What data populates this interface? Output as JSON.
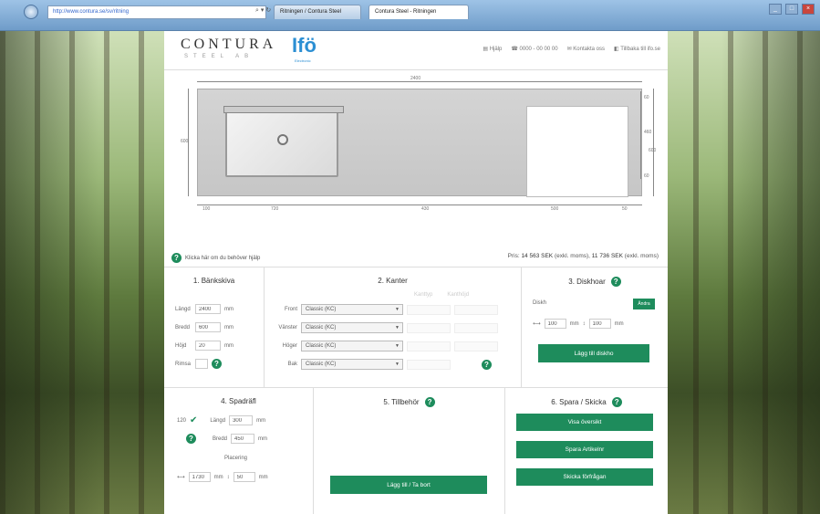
{
  "browser": {
    "address": "http://www.contura.se/sv/ritning",
    "tabs": [
      "Ritningen / Contura Steel",
      "Contura Steel - Ritningen"
    ],
    "win_buttons": [
      "_",
      "□",
      "×"
    ]
  },
  "header": {
    "logo": "CONTURA",
    "logo_sub": "STEEL AB",
    "partner_logo": "Ifö",
    "partner_sub": "Electronic",
    "nav": [
      "Hjälp",
      "0000 - 00 00 00",
      "Kontakta oss",
      "Tillbaka till ifo.se"
    ]
  },
  "drawing": {
    "top_length": "2400",
    "left_height": "600",
    "bottom_dims": [
      "100",
      "720",
      "430",
      "500",
      "50"
    ],
    "right_dims_a": [
      "60",
      "460",
      "60"
    ],
    "right_dims_b": "600"
  },
  "help_link": "Klicka här om du behöver hjälp",
  "price": {
    "label": "Pris:",
    "excl": "14 563 SEK",
    "excl_note": "(exkl. moms),",
    "incl": "11 736 SEK",
    "incl_note": "(exkl. moms)"
  },
  "bankskiva": {
    "title": "1. Bänkskiva",
    "fields": [
      {
        "label": "Längd",
        "value": "2400",
        "unit": "mm"
      },
      {
        "label": "Bredd",
        "value": "600",
        "unit": "mm"
      },
      {
        "label": "Höjd",
        "value": "20",
        "unit": "mm"
      }
    ],
    "rimsa_label": "Rimsa"
  },
  "kanter": {
    "title": "2. Kanter",
    "rows": [
      {
        "label": "Front",
        "value": "Classic (KC)"
      },
      {
        "label": "Vänster",
        "value": "Classic (KC)"
      },
      {
        "label": "Höger",
        "value": "Classic (KC)"
      },
      {
        "label": "Bak",
        "value": "Classic (KC)"
      }
    ],
    "ghost_cols": [
      "Kanttyp",
      "Kanthöjd"
    ]
  },
  "diskhoar": {
    "title": "3. Diskhoar",
    "item": "Diskh",
    "item_btn": "Ändra",
    "x_value": "100",
    "x_unit": "mm",
    "y_value": "100",
    "y_unit": "mm",
    "add_button": "Lägg till diskho"
  },
  "spadrafl": {
    "title": "4. Spadräfl",
    "label_120": "120",
    "length_label": "Längd",
    "length_value": "300",
    "length_unit": "mm",
    "width_label": "Bredd",
    "width_value": "450",
    "width_unit": "mm",
    "placement_label": "Placering",
    "px_value": "1730",
    "px_unit": "mm",
    "py_value": "50",
    "py_unit": "mm"
  },
  "tillbehor": {
    "title": "5. Tillbehör",
    "button": "Lägg till / Ta bort"
  },
  "spara": {
    "title": "6. Spara / Skicka",
    "buttons": [
      "Visa översikt",
      "Spara Artikelnr",
      "Skicka förfrågan"
    ]
  }
}
